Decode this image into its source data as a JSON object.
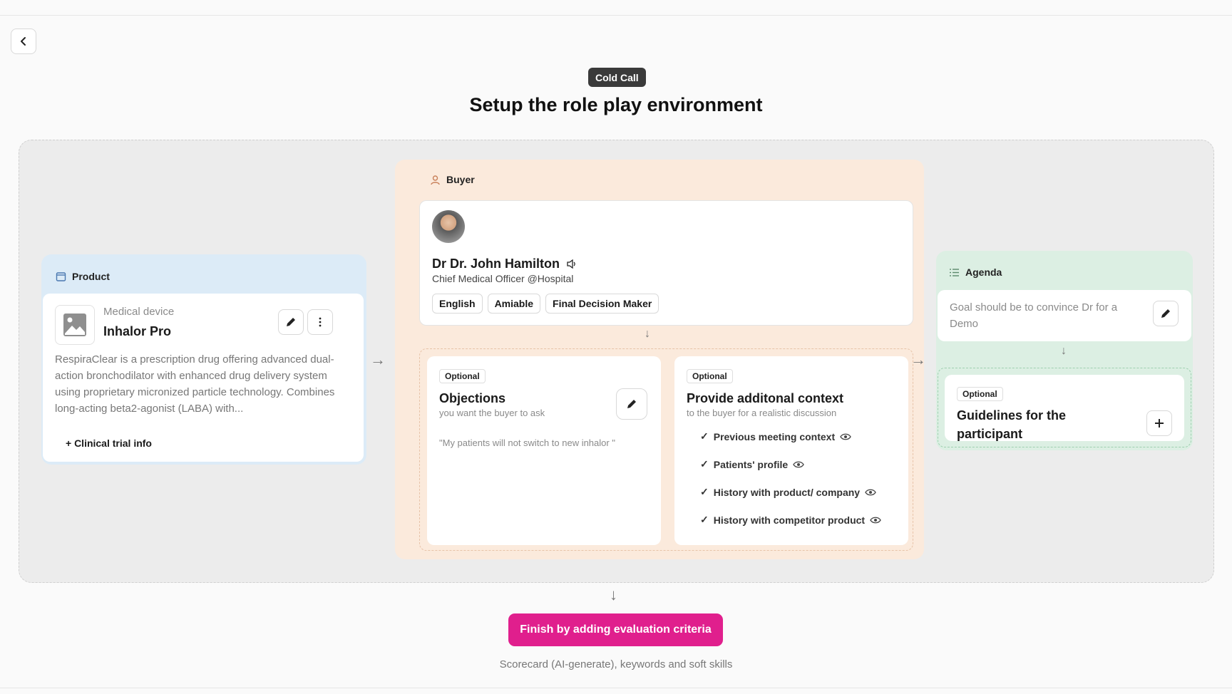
{
  "header": {
    "badge": "Cold Call",
    "title": "Setup the role play environment"
  },
  "product": {
    "section_label": "Product",
    "category": "Medical device",
    "name": "Inhalor Pro",
    "description": "RespiraClear is a prescription drug offering advanced dual-action bronchodilator with enhanced drug delivery system using proprietary micronized particle technology. Combines long-acting beta2-agonist (LABA) with...",
    "add_link": "+ Clinical trial info"
  },
  "buyer": {
    "section_label": "Buyer",
    "name": "Dr Dr. John Hamilton",
    "role": "Chief Medical Officer @Hospital",
    "tags": [
      "English",
      "Amiable",
      "Final Decision Maker"
    ]
  },
  "objections": {
    "badge": "Optional",
    "title": "Objections",
    "subtitle": "you want the buyer to ask",
    "example": "\"My patients will not switch to new inhalor \""
  },
  "context": {
    "badge": "Optional",
    "title": "Provide additonal context",
    "subtitle": "to the buyer for a realistic discussion",
    "items": [
      "Previous meeting context",
      "Patients' profile",
      "History with product/ company",
      "History with competitor product"
    ]
  },
  "agenda": {
    "section_label": "Agenda",
    "goal": "Goal should be to convince Dr for a Demo",
    "guidelines_badge": "Optional",
    "guidelines_title": "Guidelines for the participant"
  },
  "footer": {
    "cta_label": "Finish by adding evaluation criteria",
    "cta_sub": "Scorecard (AI-generate), keywords and soft skills"
  },
  "colors": {
    "accent": "#e01f8d",
    "product_panel": "#dcebf7",
    "buyer_panel": "#fbeadc",
    "agenda_panel": "#dcefe3"
  }
}
